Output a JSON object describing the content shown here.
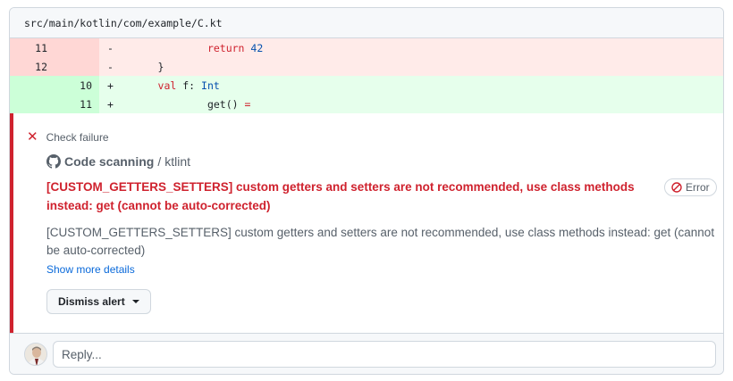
{
  "file": {
    "path": "src/main/kotlin/com/example/C.kt"
  },
  "diff": [
    {
      "type": "del",
      "old": "11",
      "new": "",
      "marker": "-",
      "indent": "              ",
      "parts": [
        {
          "t": "return",
          "c": "kw"
        },
        {
          "t": " "
        },
        {
          "t": "42",
          "c": "num"
        }
      ]
    },
    {
      "type": "del",
      "old": "12",
      "new": "",
      "marker": "-",
      "indent": "      ",
      "parts": [
        {
          "t": "}"
        }
      ]
    },
    {
      "type": "add",
      "old": "",
      "new": "10",
      "marker": "+",
      "indent": "      ",
      "parts": [
        {
          "t": "val",
          "c": "kw"
        },
        {
          "t": " f: "
        },
        {
          "t": "Int",
          "c": "typ"
        }
      ]
    },
    {
      "type": "add",
      "old": "",
      "new": "11",
      "marker": "+",
      "indent": "              ",
      "parts": [
        {
          "t": "get() "
        },
        {
          "t": "=",
          "c": "kw"
        }
      ]
    }
  ],
  "alert": {
    "status": "Check failure",
    "tool_name": "Code scanning",
    "tool_sep": "/",
    "tool_linter": "ktlint",
    "title": "[CUSTOM_GETTERS_SETTERS] custom getters and setters are not recommended, use class methods instead: get (cannot be auto-corrected)",
    "severity": "Error",
    "description": "[CUSTOM_GETTERS_SETTERS] custom getters and setters are not recommended, use class methods instead: get (cannot be auto-corrected)",
    "show_more": "Show more details",
    "dismiss": "Dismiss alert"
  },
  "reply": {
    "placeholder": "Reply..."
  },
  "colors": {
    "danger": "#cf222e",
    "link": "#0969da",
    "del_bg": "#ffebe9",
    "add_bg": "#e6ffec"
  }
}
